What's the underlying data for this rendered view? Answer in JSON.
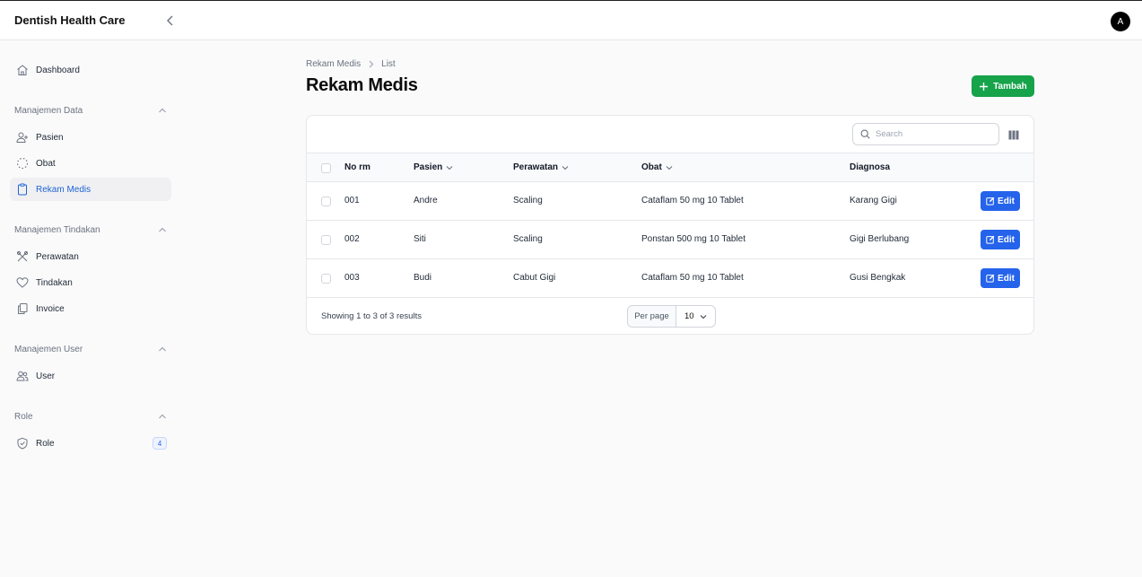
{
  "app": {
    "title": "Dentish Health Care",
    "avatar_initial": "A"
  },
  "sidebar": {
    "dashboard": {
      "label": "Dashboard",
      "icon": "home-icon"
    },
    "groups": [
      {
        "label": "Manajemen Data",
        "items": [
          {
            "label": "Pasien",
            "icon": "user-plus-icon"
          },
          {
            "label": "Obat",
            "icon": "dotted-circle-icon"
          },
          {
            "label": "Rekam Medis",
            "icon": "clipboard-icon",
            "active": true
          }
        ]
      },
      {
        "label": "Manajemen Tindakan",
        "items": [
          {
            "label": "Perawatan",
            "icon": "tools-icon"
          },
          {
            "label": "Tindakan",
            "icon": "heart-icon"
          },
          {
            "label": "Invoice",
            "icon": "documents-icon"
          }
        ]
      },
      {
        "label": "Manajemen User",
        "items": [
          {
            "label": "User",
            "icon": "users-icon"
          }
        ]
      },
      {
        "label": "Role",
        "items": [
          {
            "label": "Role",
            "icon": "shield-check-icon",
            "badge": "4"
          }
        ]
      }
    ]
  },
  "breadcrumb": {
    "parent": "Rekam Medis",
    "current": "List"
  },
  "page": {
    "title": "Rekam Medis",
    "add_label": "Tambah"
  },
  "table": {
    "search_placeholder": "Search",
    "columns": [
      "No rm",
      "Pasien",
      "Perawatan",
      "Obat",
      "Diagnosa"
    ],
    "rows": [
      {
        "no_rm": "001",
        "pasien": "Andre",
        "perawatan": "Scaling",
        "obat": "Cataflam 50 mg 10 Tablet",
        "diagnosa": "Karang Gigi"
      },
      {
        "no_rm": "002",
        "pasien": "Siti",
        "perawatan": "Scaling",
        "obat": "Ponstan 500 mg 10 Tablet",
        "diagnosa": "Gigi Berlubang"
      },
      {
        "no_rm": "003",
        "pasien": "Budi",
        "perawatan": "Cabut Gigi",
        "obat": "Cataflam 50 mg 10 Tablet",
        "diagnosa": "Gusi Bengkak"
      }
    ],
    "edit_label": "Edit",
    "footer_info": "Showing 1 to 3 of 3 results",
    "per_page_label": "Per page",
    "per_page_value": "10"
  },
  "colors": {
    "accent": "#2563eb",
    "success": "#16a34a",
    "active_bg": "#f0f0f2"
  }
}
